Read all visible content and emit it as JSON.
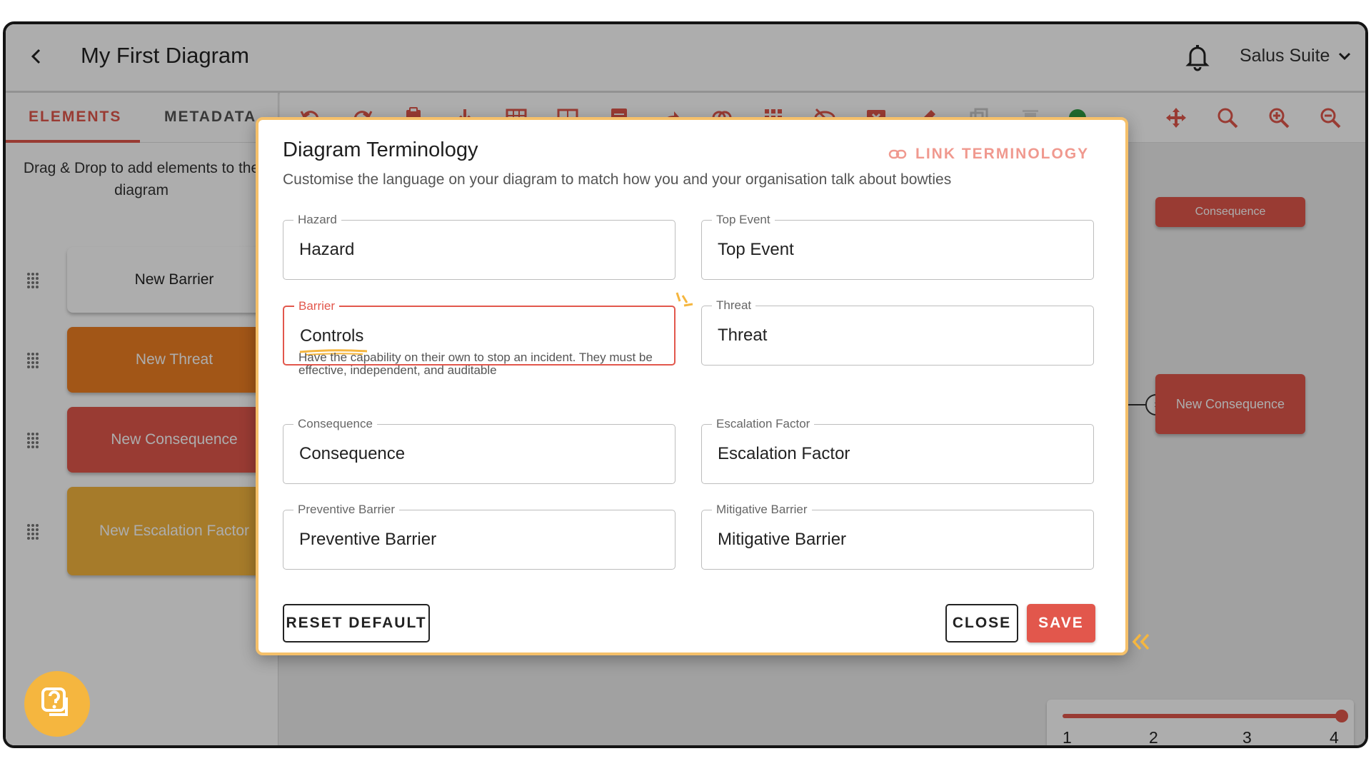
{
  "header": {
    "title": "My First Diagram",
    "account": "Salus Suite"
  },
  "sidebar": {
    "tabs": [
      {
        "label": "ELEMENTS",
        "active": true
      },
      {
        "label": "METADATA",
        "active": false
      }
    ],
    "hint": "Drag & Drop to add elements to the diagram",
    "elements": [
      {
        "label": "New Barrier",
        "color": "#ffffff",
        "text_color": "#222222"
      },
      {
        "label": "New Threat",
        "color": "#ef7f22",
        "text_color": "#ffffff"
      },
      {
        "label": "New Consequence",
        "color": "#e2574c",
        "text_color": "#ffffff"
      },
      {
        "label": "New Escalation Factor",
        "color": "#f5b63f",
        "text_color": "#ffffff"
      }
    ]
  },
  "canvas": {
    "nodes": [
      "Consequence",
      "New Consequence"
    ],
    "level_labels": [
      "1",
      "2",
      "3",
      "4"
    ],
    "level_value": 4
  },
  "modal": {
    "title": "Diagram Terminology",
    "link_label": "LINK TERMINOLOGY",
    "subtitle": "Customise the language on your diagram to match how you and your organisation talk about bowties",
    "fields": {
      "hazard": {
        "label": "Hazard",
        "value": "Hazard"
      },
      "top_event": {
        "label": "Top Event",
        "value": "Top Event"
      },
      "barrier": {
        "label": "Barrier",
        "value": "Controls",
        "helper": "Have the capability on their own to stop an incident. They must be effective, independent, and auditable"
      },
      "threat": {
        "label": "Threat",
        "value": "Threat"
      },
      "consequence": {
        "label": "Consequence",
        "value": "Consequence"
      },
      "escalation_factor": {
        "label": "Escalation Factor",
        "value": "Escalation Factor"
      },
      "preventive_barrier": {
        "label": "Preventive Barrier",
        "value": "Preventive Barrier"
      },
      "mitigative_barrier": {
        "label": "Mitigative Barrier",
        "value": "Mitigative Barrier"
      }
    },
    "buttons": {
      "reset": "RESET DEFAULT",
      "close": "CLOSE",
      "save": "SAVE"
    }
  },
  "colors": {
    "accent": "#e2574c",
    "highlight": "#f5b63f"
  }
}
